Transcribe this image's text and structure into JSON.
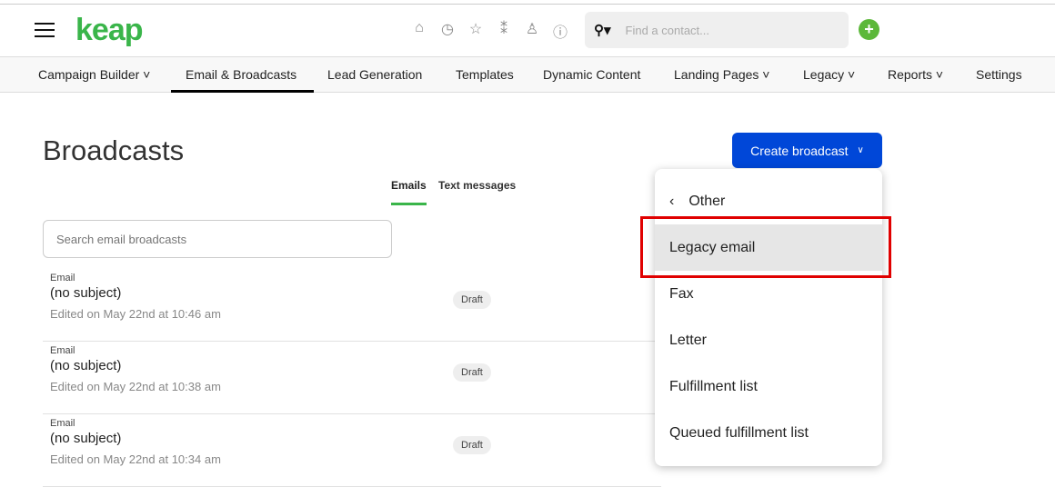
{
  "header": {
    "logo": "keap",
    "search_placeholder": "Find a contact...",
    "icons": [
      "home-icon",
      "history-icon",
      "star-icon",
      "activity-icon",
      "person-icon",
      "help-icon"
    ]
  },
  "nav": [
    {
      "label": "Campaign Builder ˅"
    },
    {
      "label": "Email & Broadcasts"
    },
    {
      "label": "Lead Generation"
    },
    {
      "label": "Templates"
    },
    {
      "label": "Dynamic Content"
    },
    {
      "label": "Landing Pages ˅"
    },
    {
      "label": "Legacy ˅"
    },
    {
      "label": "Reports ˅"
    },
    {
      "label": "Settings"
    }
  ],
  "page": {
    "title": "Broadcasts",
    "tabs": [
      "Emails",
      "Text messages"
    ],
    "search_placeholder": "Search email broadcasts",
    "create_label": "Create broadcast"
  },
  "rows": [
    {
      "kind": "Email",
      "subject": "(no subject)",
      "edited": "Edited on May 22nd at 10:46 am",
      "status": "Draft"
    },
    {
      "kind": "Email",
      "subject": "(no subject)",
      "edited": "Edited on May 22nd at 10:38 am",
      "status": "Draft"
    },
    {
      "kind": "Email",
      "subject": "(no subject)",
      "edited": "Edited on May 22nd at 10:34 am",
      "status": "Draft"
    }
  ],
  "menu": {
    "back_label": "Other",
    "items": [
      "Legacy email",
      "Fax",
      "Letter",
      "Fulfillment list",
      "Queued fulfillment list"
    ],
    "highlighted": "Legacy email"
  },
  "colors": {
    "brand": "#3ab54a",
    "primary": "#0047d8",
    "highlight_box": "#e00000"
  }
}
